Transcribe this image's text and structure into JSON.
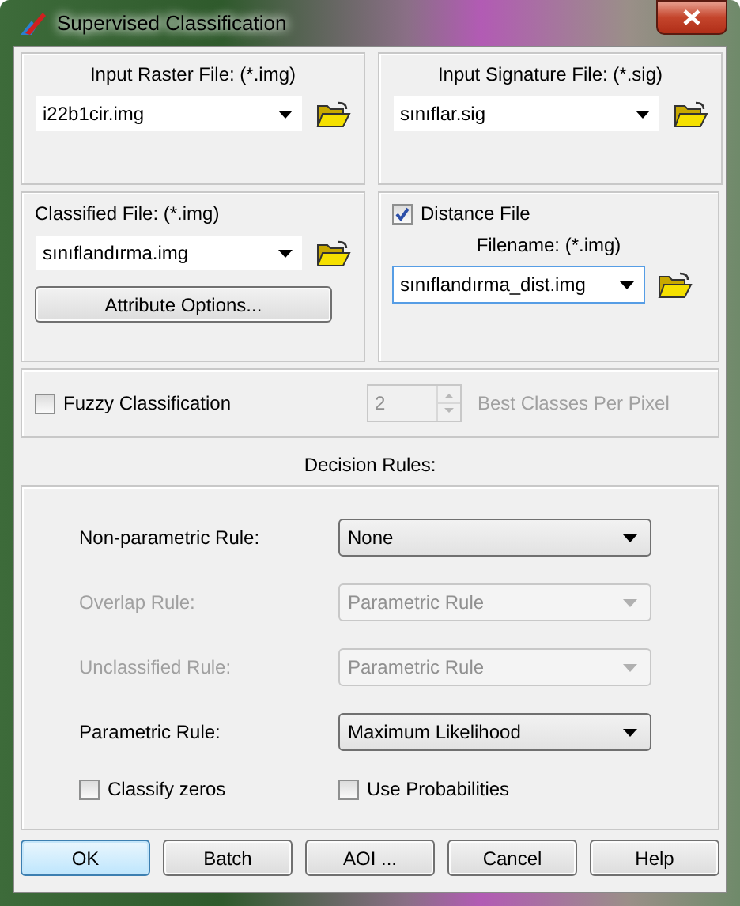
{
  "window": {
    "title": "Supervised Classification"
  },
  "input_raster": {
    "label": "Input Raster File: (*.img)",
    "value": "i22b1cir.img"
  },
  "input_signature": {
    "label": "Input Signature File: (*.sig)",
    "value": "sınıflar.sig"
  },
  "classified": {
    "label": "Classified File: (*.img)",
    "value": "sınıflandırma.img",
    "button": "Attribute Options..."
  },
  "distance": {
    "label": "Distance File",
    "checked": true,
    "filename_label": "Filename: (*.img)",
    "value": "sınıflandırma_dist.img"
  },
  "fuzzy": {
    "label": "Fuzzy Classification",
    "checked": false,
    "count": "2",
    "count_label": "Best Classes Per Pixel",
    "disabled": true
  },
  "decision_rules": {
    "title": "Decision Rules:",
    "rules": [
      {
        "label": "Non-parametric Rule:",
        "value": "None",
        "disabled": false
      },
      {
        "label": "Overlap Rule:",
        "value": "Parametric Rule",
        "disabled": true
      },
      {
        "label": "Unclassified Rule:",
        "value": "Parametric Rule",
        "disabled": true
      },
      {
        "label": "Parametric Rule:",
        "value": "Maximum Likelihood",
        "disabled": false
      }
    ],
    "options": [
      {
        "label": "Classify zeros",
        "checked": false
      },
      {
        "label": "Use Probabilities",
        "checked": false
      }
    ]
  },
  "buttons": [
    {
      "label": "OK",
      "default": true
    },
    {
      "label": "Batch",
      "default": false
    },
    {
      "label": "AOI ...",
      "default": false
    },
    {
      "label": "Cancel",
      "default": false
    },
    {
      "label": "Help",
      "default": false
    }
  ]
}
